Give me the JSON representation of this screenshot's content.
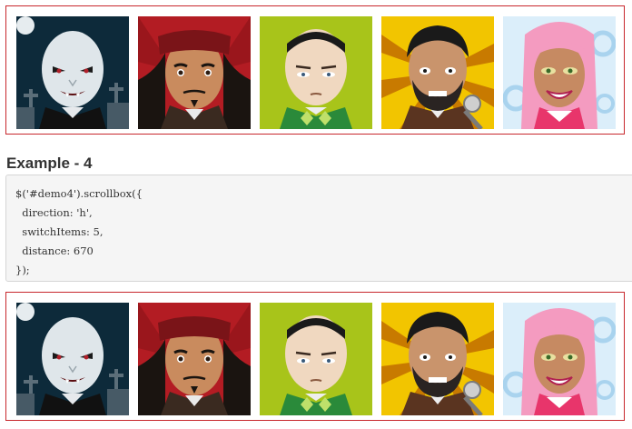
{
  "heading": "Example - 4",
  "code_lines": [
    "$('#demo4').scrollbox({",
    "  direction: 'h',",
    "  switchItems: 5,",
    "  distance: 670",
    "});"
  ],
  "avatars": [
    {
      "icon": "vampire-avatar-icon"
    },
    {
      "icon": "pirate-avatar-icon"
    },
    {
      "icon": "bald-man-avatar-icon"
    },
    {
      "icon": "bearded-singer-avatar-icon"
    },
    {
      "icon": "pink-hair-woman-avatar-icon"
    }
  ],
  "colors": {
    "border": "#c8282d",
    "code_bg": "#f5f5f5",
    "code_border": "#d6d6d6",
    "text": "#333333"
  }
}
